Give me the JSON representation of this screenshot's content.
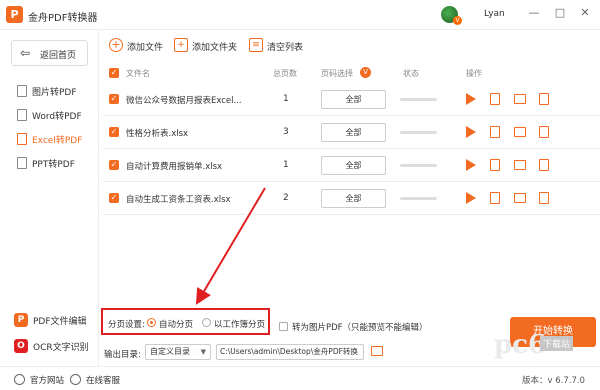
{
  "app": {
    "title": "金舟PDF转换器",
    "logo_letter": "P",
    "brand_color": "#f26b21"
  },
  "user": {
    "name": "Lyan",
    "vip_badge": "V"
  },
  "window": {
    "minimize": "—",
    "maximize": "□",
    "close": "✕"
  },
  "sidebar": {
    "back_label": "返回首页",
    "items": [
      {
        "label": "图片转PDF",
        "active": false
      },
      {
        "label": "Word转PDF",
        "active": false
      },
      {
        "label": "Excel转PDF",
        "active": true
      },
      {
        "label": "PPT转PDF",
        "active": false
      }
    ],
    "tools": [
      {
        "label": "PDF文件编辑",
        "icon": "pdf-edit-icon"
      },
      {
        "label": "OCR文字识别",
        "icon": "ocr-icon"
      }
    ]
  },
  "toolbar": {
    "add_file": "添加文件",
    "add_folder": "添加文件夹",
    "clear_list": "清空列表"
  },
  "table": {
    "columns": [
      "文件名",
      "总页数",
      "页码选择",
      "状态",
      "操作"
    ],
    "rows": [
      {
        "name": "微信公众号数据月报表Excel...",
        "pages": "1",
        "range": "全部"
      },
      {
        "name": "性格分析表.xlsx",
        "pages": "3",
        "range": "全部"
      },
      {
        "name": "自动计算费用报销单.xlsx",
        "pages": "1",
        "range": "全部"
      },
      {
        "name": "自动生成工资条工资表.xlsx",
        "pages": "2",
        "range": "全部"
      }
    ]
  },
  "settings": {
    "page_split_label": "分页设置:",
    "option_auto": "自动分页",
    "option_sheet": "以工作簿分页",
    "to_image_label": "转为图片PDF（只能预览不能编辑）",
    "output_label": "输出目录:",
    "output_mode": "自定义目录",
    "output_path": "C:\\Users\\admin\\Desktop\\金舟PDF转换",
    "start_button": "开始转换"
  },
  "footer": {
    "website": "官方网站",
    "support": "在线客服",
    "version": "版本：v 6.7.7.0"
  },
  "watermark": {
    "text": "pc6",
    "sub": "下载站"
  }
}
